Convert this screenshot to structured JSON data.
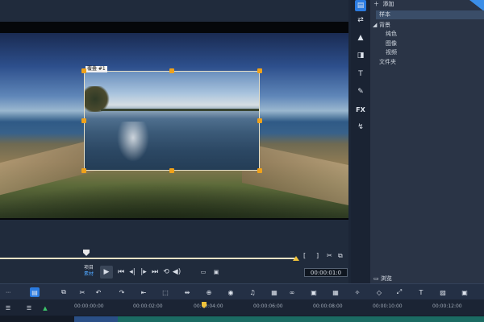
{
  "library": {
    "add_label": "添加",
    "items": [
      {
        "label": "样本",
        "level": 0
      },
      {
        "label": "背景",
        "level": 0
      },
      {
        "label": "纯色",
        "level": 1
      },
      {
        "label": "图像",
        "level": 1
      },
      {
        "label": "视频",
        "level": 1
      },
      {
        "label": "文件夹",
        "level": 0
      }
    ],
    "browse_label": "浏览"
  },
  "preview": {
    "clip_tag": "覆叠 #1",
    "mode_labels": [
      "项目",
      "素材"
    ],
    "timecode": "00:00:01:0"
  },
  "tools": [
    "media-icon",
    "transition-icon",
    "title-icon",
    "graphics-icon",
    "text-icon",
    "filter-icon",
    "FX",
    "path-icon"
  ],
  "fx_label": "FX",
  "text_tool_label": "T",
  "timeline": {
    "ticks": [
      "00:00:00:00",
      "00:00:02:00",
      "00:00:04:00",
      "00:00:06:00",
      "00:00:08:00",
      "00:00:10:00",
      "00:00:12:00"
    ]
  },
  "colors": {
    "accent": "#2b7be0",
    "handle": "#f0a21a",
    "playhead": "#f0c23a"
  }
}
